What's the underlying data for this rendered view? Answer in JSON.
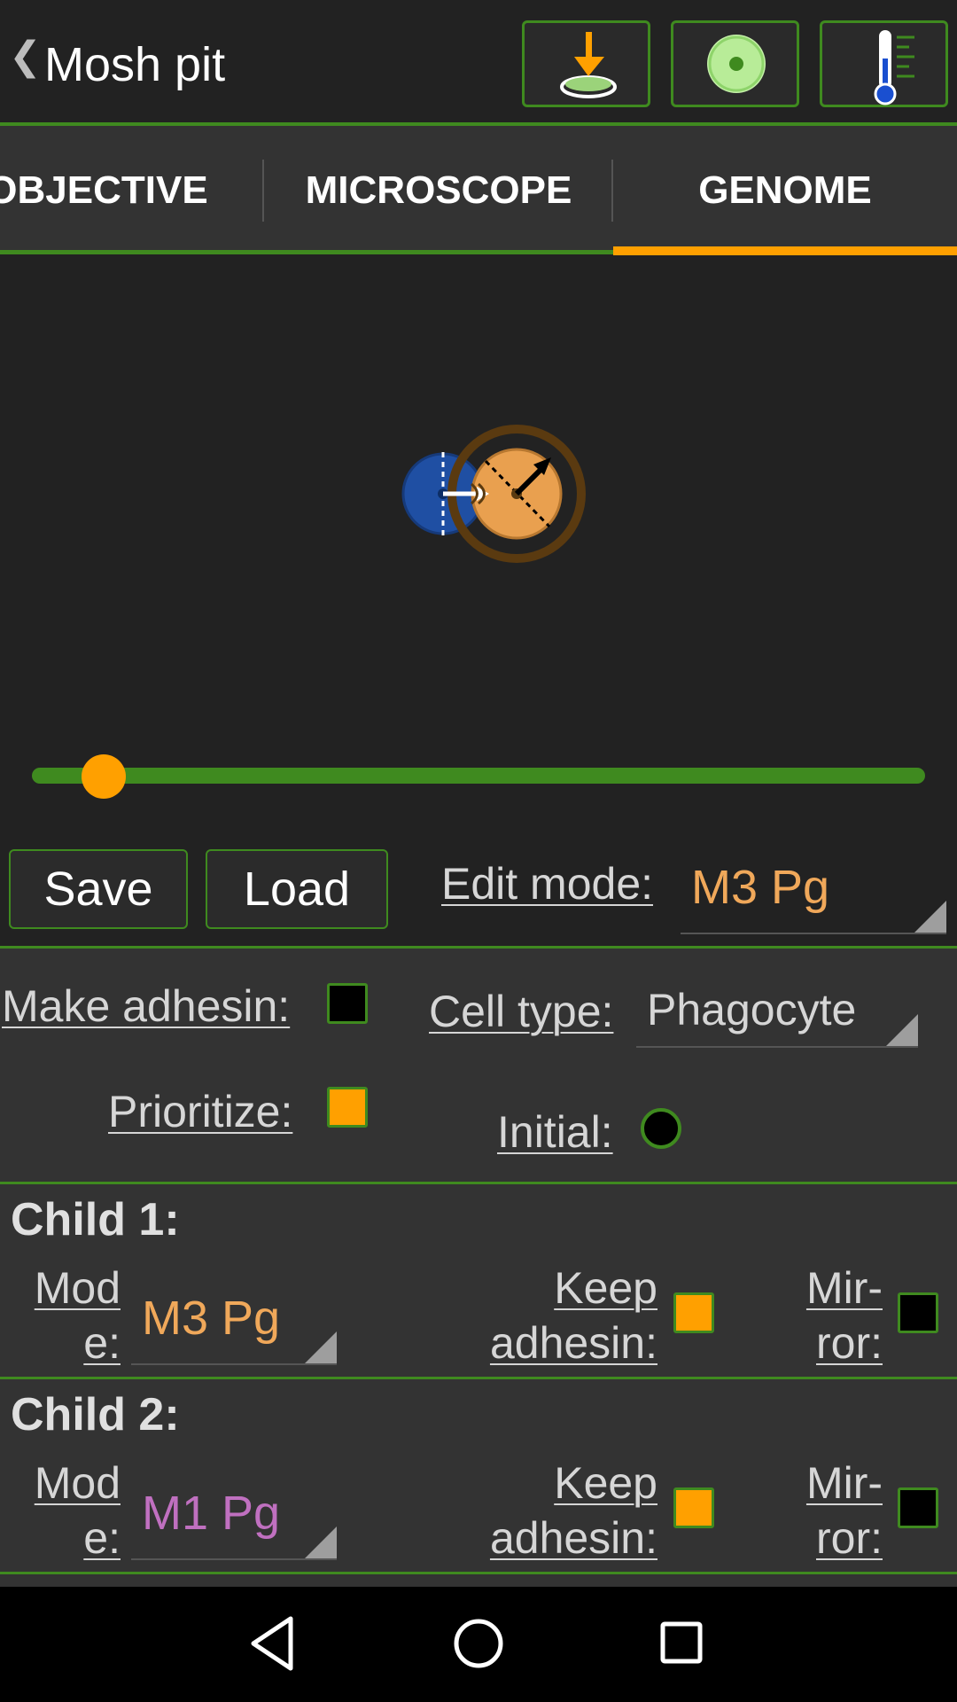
{
  "header": {
    "back_glyph": "❮",
    "title": "Mosh pit",
    "buttons": [
      {
        "icon": "petri-dish-download-icon"
      },
      {
        "icon": "cell-target-icon"
      },
      {
        "icon": "thermometer-icon"
      }
    ]
  },
  "tabs": [
    {
      "label": "OBJECTIVE",
      "active": false
    },
    {
      "label": "MICROSCOPE",
      "active": false
    },
    {
      "label": "GENOME",
      "active": true
    }
  ],
  "colors": {
    "accent_green": "#3f8a1f",
    "accent_orange": "#ffa000",
    "mode_orange": "#f0a85a",
    "mode_purple": "#c070c0",
    "cell_blue": "#1f4fa3",
    "cell_orange": "#e9a04f"
  },
  "slider": {
    "value_fraction": 0.08
  },
  "actions": {
    "save_label": "Save",
    "load_label": "Load",
    "edit_mode_label": "Edit mode:",
    "edit_mode_value": "M3 Pg"
  },
  "cell": {
    "make_adhesin_label": "Make adhesin:",
    "make_adhesin_checked": false,
    "cell_type_label": "Cell type:",
    "cell_type_value": "Phagocyte",
    "prioritize_label": "Prioritize:",
    "prioritize_checked": true,
    "initial_label": "Initial:"
  },
  "child1": {
    "title": "Child 1:",
    "mode_label_1": "Mod",
    "mode_label_2": "e:",
    "mode_value": "M3 Pg",
    "keep_label_1": "Keep",
    "keep_label_2": "adhesin:",
    "keep_checked": true,
    "mirror_label_1": "Mir-",
    "mirror_label_2": "ror:",
    "mirror_checked": false
  },
  "child2": {
    "title": "Child 2:",
    "mode_label_1": "Mod",
    "mode_label_2": "e:",
    "mode_value": "M1 Pg",
    "keep_label_1": "Keep",
    "keep_label_2": "adhesin:",
    "keep_checked": true,
    "mirror_label_1": "Mir-",
    "mirror_label_2": "ror:",
    "mirror_checked": false
  },
  "navbar": {
    "icons": [
      "back-triangle-icon",
      "home-circle-icon",
      "recents-square-icon"
    ]
  }
}
